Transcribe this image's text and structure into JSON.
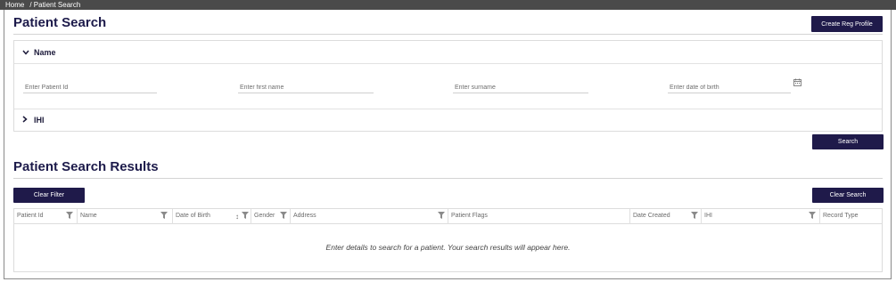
{
  "breadcrumb": {
    "home": "Home",
    "current": "/ Patient Search"
  },
  "header": {
    "title": "Patient Search",
    "create_button": "Create Reg Profile"
  },
  "search_panel": {
    "name_section": {
      "label": "Name",
      "expanded": true
    },
    "fields": {
      "patient_id": {
        "placeholder": "Enter Patient Id",
        "value": ""
      },
      "first_name": {
        "placeholder": "Enter first name",
        "value": ""
      },
      "surname": {
        "placeholder": "Enter surname",
        "value": ""
      },
      "dob": {
        "placeholder": "Enter date of birth",
        "value": ""
      }
    },
    "ihi_section": {
      "label": "IHI",
      "expanded": false
    },
    "search_button": "Search"
  },
  "results": {
    "title": "Patient Search Results",
    "clear_filter_button": "Clear Filter",
    "clear_search_button": "Clear Search",
    "columns": [
      {
        "label": "Patient Id",
        "filter": true
      },
      {
        "label": "Name",
        "filter": true
      },
      {
        "label": "Date of Birth",
        "filter": true,
        "sort": true
      },
      {
        "label": "Gender",
        "filter": true
      },
      {
        "label": "Address",
        "filter": true
      },
      {
        "label": "Patient Flags",
        "filter": false
      },
      {
        "label": "Date Created",
        "filter": true
      },
      {
        "label": "IHI",
        "filter": true
      },
      {
        "label": "Record Type",
        "filter": false
      }
    ],
    "empty_message": "Enter details to search for a patient. Your search results will appear here."
  },
  "colors": {
    "primary": "#1f1a4a",
    "breadcrumb_bg": "#4a4a4a",
    "border": "#dcdcdc"
  }
}
